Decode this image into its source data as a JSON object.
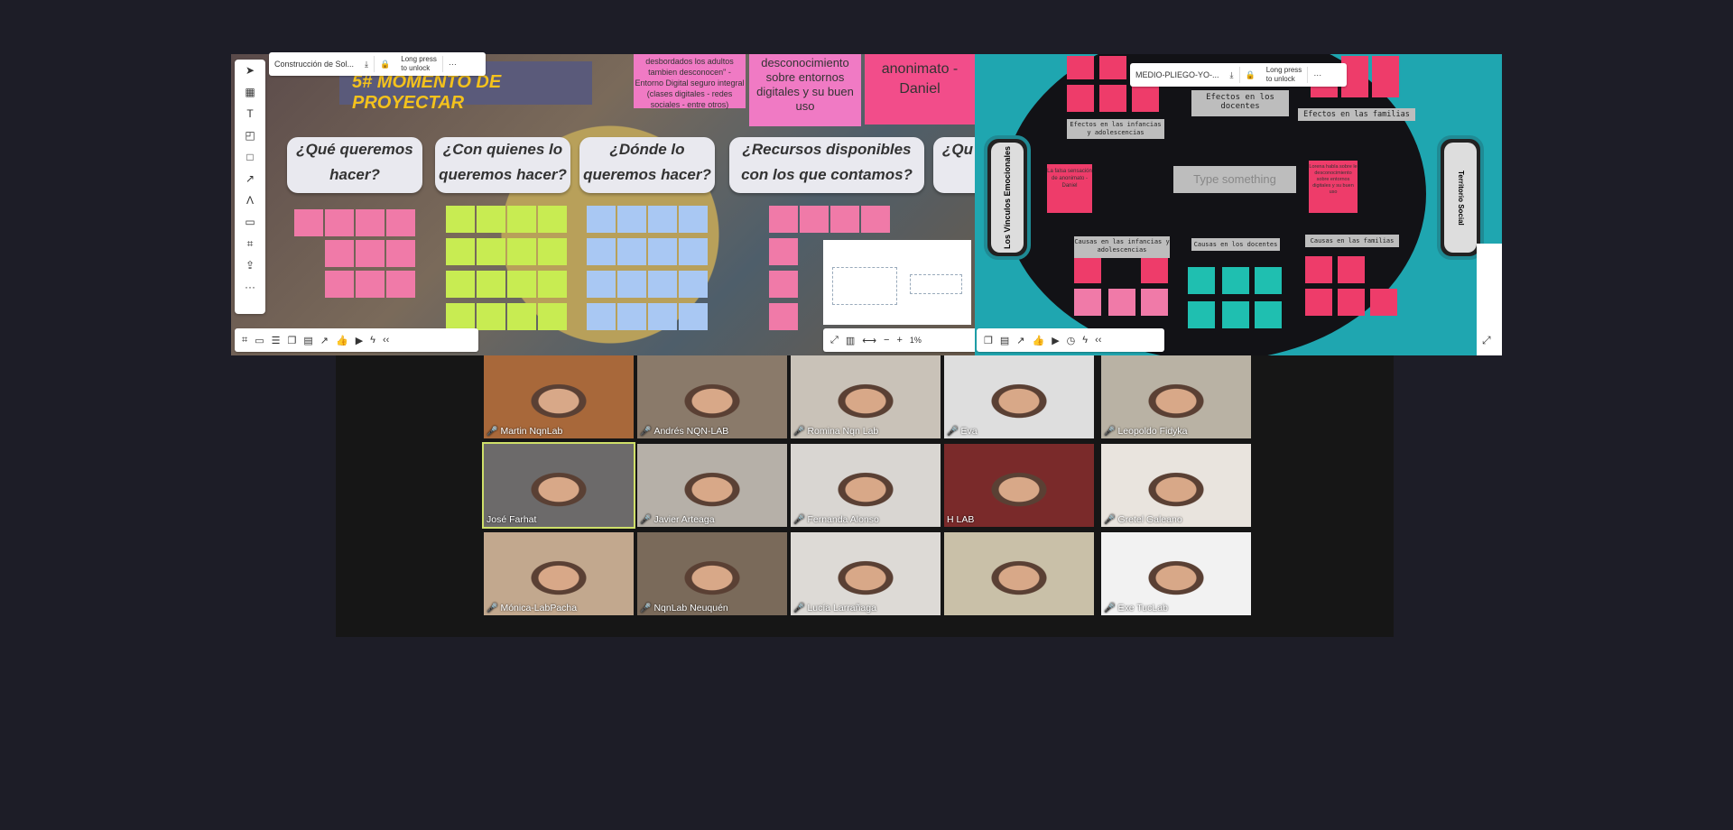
{
  "left_board": {
    "file_name": "Construcción de Sol...",
    "lock_text_1": "Long press",
    "lock_text_2": "to unlock",
    "more": "···",
    "title": "5# Momento de proyectar",
    "top_note_1": "desbordados los adultos tambien desconocen\" - Entorno Digital seguro integral (clases digitales - redes sociales - entre otros)",
    "top_note_2": "desconocimiento sobre entornos digitales y su buen uso",
    "top_note_3": "anonimato - Daniel",
    "headings": [
      "¿Qué queremos hacer?",
      "¿Con quienes lo queremos hacer?",
      "¿Dónde lo queremos hacer?",
      "¿Recursos disponibles con los que contamos?",
      "¿Qu E"
    ],
    "zoom": "1%"
  },
  "right_board": {
    "file_name": "MEDIO-PLIEGO-YO-...",
    "lock_text_1": "Long press",
    "lock_text_2": "to unlock",
    "more": "···",
    "left_pill": "Los Vínculos Emocionales",
    "right_pill": "Territorio Social",
    "labels": {
      "efectos_docentes": "Efectos en los docentes",
      "efectos_familias": "Efectos en las familias",
      "efectos_infancias": "Efectos en las infancias y adolescencias",
      "causas_infancias": "Causas en las infancias y adolescencias",
      "causas_docentes": "Causas en los docentes",
      "causas_familias": "Causas en las familias"
    },
    "type_placeholder": "Type something",
    "note_left": "La falsa sensación de anonimato - Daniel",
    "note_right": "Lorena habla sobre le desconocimiento sobre entornos digitales y su buen uso"
  },
  "participants": [
    {
      "name": "Martin NqnLab",
      "bg": "#a8683a"
    },
    {
      "name": "Andrés NQN-LAB",
      "bg": "#8a7a6a"
    },
    {
      "name": "Romina Nqn Lab",
      "bg": "#c9c2b8"
    },
    {
      "name": "Eva",
      "bg": "#dedede"
    },
    {
      "name": "Leopoldo Fidyka",
      "bg": "#b9b2a4"
    },
    {
      "name": "José Farhat",
      "bg": "#6c6a6a"
    },
    {
      "name": "Javier Arteaga",
      "bg": "#b6b0a8"
    },
    {
      "name": "Fernanda Alonso",
      "bg": "#d9d6d2"
    },
    {
      "name": "H LAB",
      "bg": "#7a2a2a"
    },
    {
      "name": "Gretel Galeano",
      "bg": "#e9e4de"
    },
    {
      "name": "Mónica-LabPacha",
      "bg": "#c2a88e"
    },
    {
      "name": "NqnLab Neuquén",
      "bg": "#7a6a5a"
    },
    {
      "name": "Lucía Larrañaga",
      "bg": "#dddad6"
    },
    {
      "name": "",
      "bg": "#c9c0a8"
    },
    {
      "name": "Exe TucLab",
      "bg": "#f2f2f2"
    }
  ]
}
